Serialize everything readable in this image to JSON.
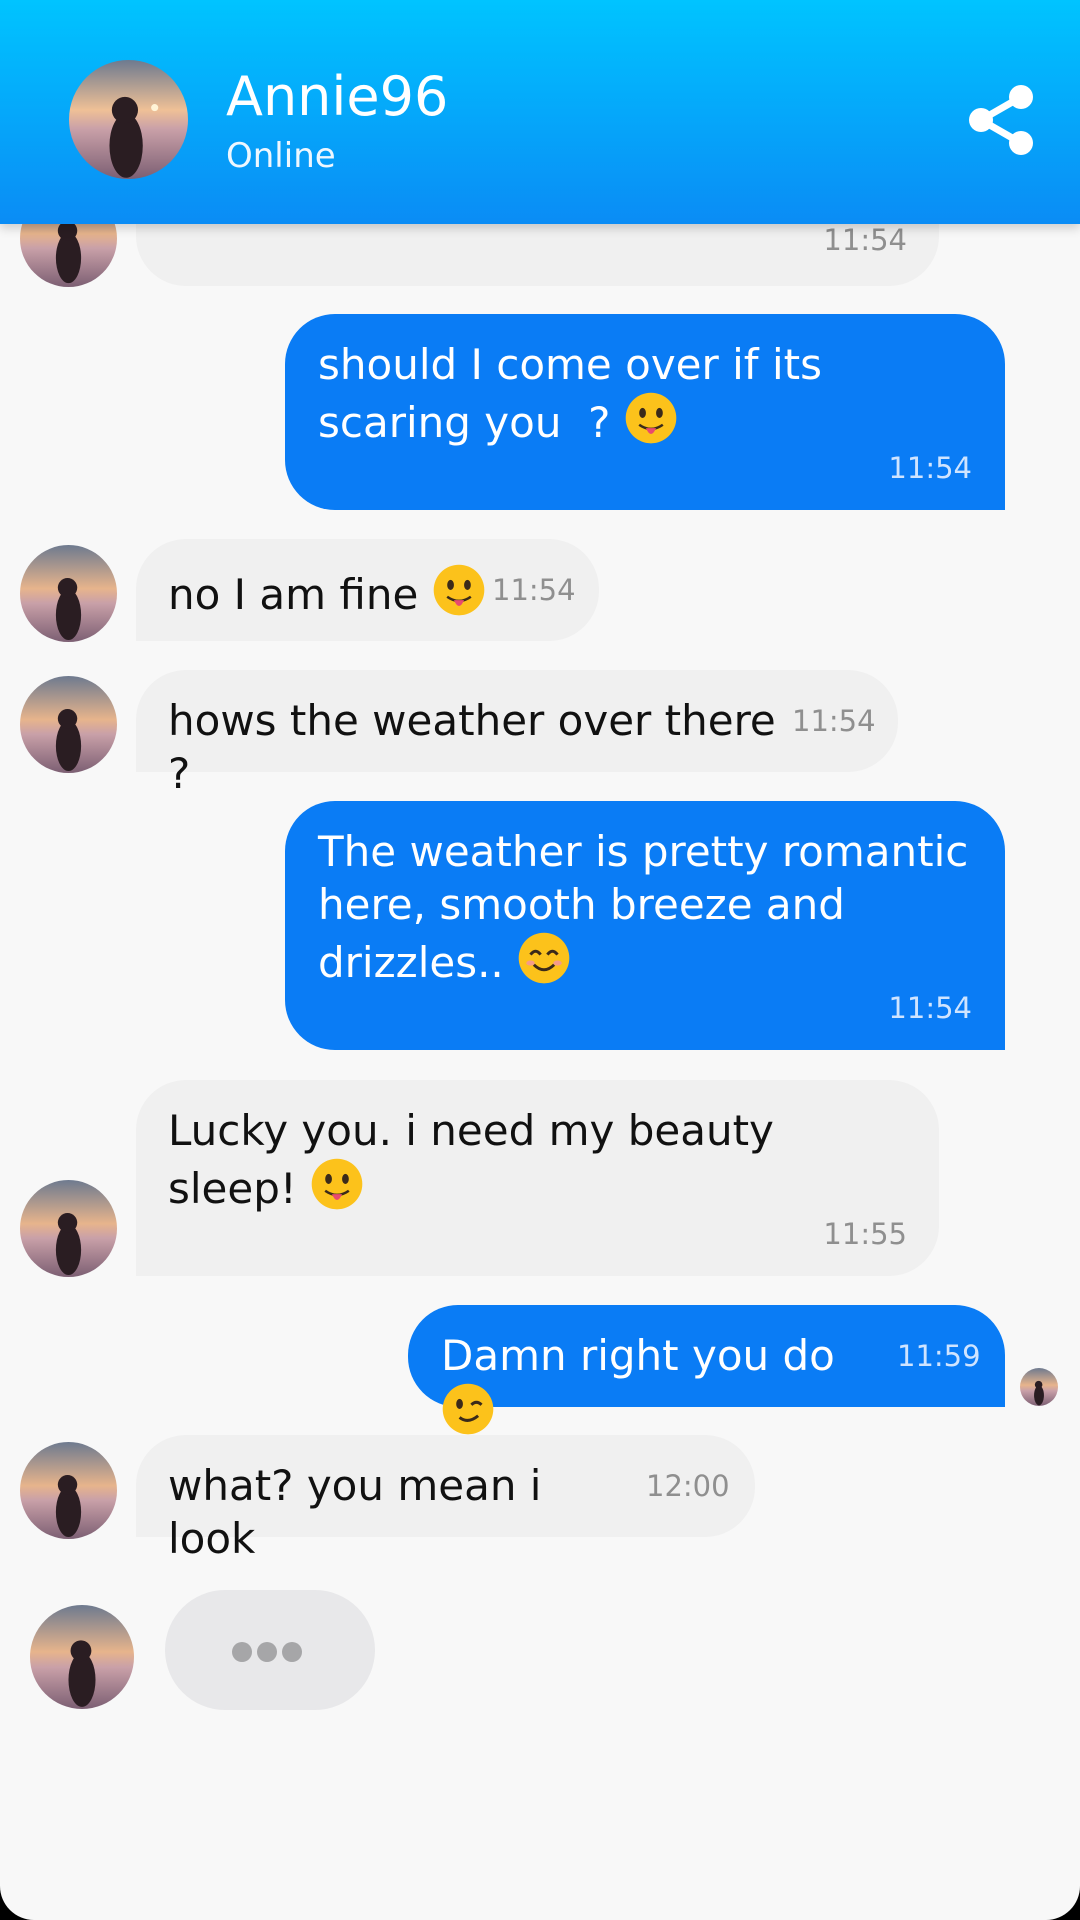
{
  "header": {
    "contact_name": "Annie96",
    "contact_status": "Online",
    "share_icon": "share-icon",
    "gradient_top": "#00c4ff",
    "gradient_bottom": "#0a8cf5"
  },
  "colors": {
    "outgoing_bubble": "#0a7cf5",
    "incoming_bubble": "#f0f0f0",
    "background": "#f8f8f8"
  },
  "messages": [
    {
      "direction": "in",
      "text": "",
      "time": "11:54"
    },
    {
      "direction": "out",
      "text": "should I come over if its scaring you  ?",
      "emoji": "tongue-emoji",
      "time": "11:54"
    },
    {
      "direction": "in",
      "text": "no I am fine",
      "emoji": "tongue-emoji",
      "time": "11:54"
    },
    {
      "direction": "in",
      "text": "hows the weather over there ?",
      "time": "11:54"
    },
    {
      "direction": "out",
      "text": "The weather is pretty romantic here, smooth breeze and drizzles..",
      "emoji": "smile-emoji",
      "time": "11:54"
    },
    {
      "direction": "in",
      "text": "Lucky you. i need my beauty sleep!",
      "emoji": "tongue-emoji",
      "time": "11:55"
    },
    {
      "direction": "out",
      "text": "Damn right you do",
      "emoji": "wink-emoji",
      "time": "11:59",
      "seen": true
    },
    {
      "direction": "in",
      "text": "what? you mean i look",
      "time": "12:00"
    }
  ],
  "typing_indicator": {
    "visible": true
  }
}
